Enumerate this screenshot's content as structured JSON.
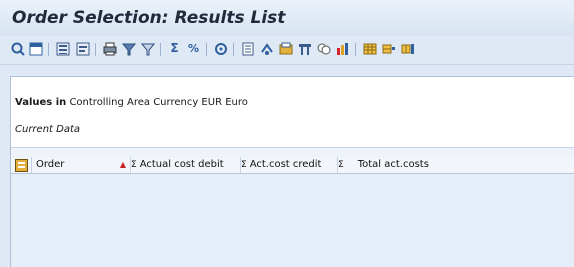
{
  "window": {
    "title": "Order Selection: Results List"
  },
  "toolbar": {
    "icons": [
      "details-icon",
      "select-all-icon",
      "save-layout-icon",
      "choose-layout-icon",
      "print-icon",
      "filter-icon",
      "delete-filter-icon",
      "sum-icon",
      "subtotals-icon",
      "export-icon",
      "word-processing-icon",
      "spreadsheet-icon",
      "local-file-icon",
      "abc-analysis-icon",
      "graphic-icon",
      "columns-icon",
      "insert-column-icon",
      "delete-column-icon"
    ]
  },
  "info": {
    "values_label": "Values in",
    "currency_text": "Controlling Area Currency EUR Euro",
    "current_data": "Current Data"
  },
  "grid": {
    "header": {
      "order": "Order",
      "sum_symbol": "Σ",
      "actual_cost_debit": "Actual cost debit",
      "act_cost_credit": "Act.cost credit",
      "total_act_costs": "Total act.costs"
    }
  }
}
